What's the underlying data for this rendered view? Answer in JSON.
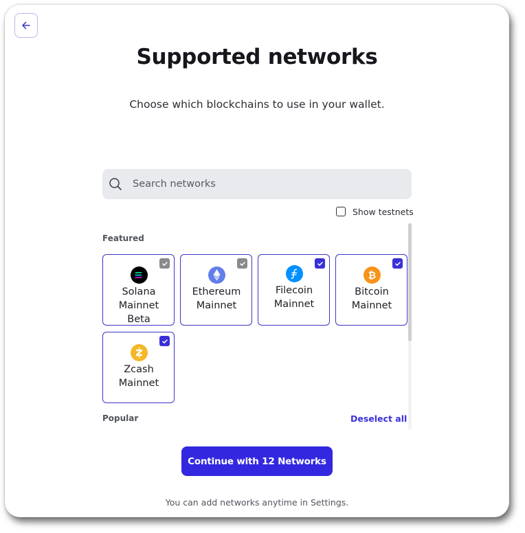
{
  "header": {
    "title": "Supported networks",
    "subtitle": "Choose which blockchains to use in your wallet."
  },
  "search": {
    "placeholder": "Search networks"
  },
  "testnets": {
    "label": "Show testnets",
    "checked": false
  },
  "sections": {
    "featured_label": "Featured",
    "popular_label": "Popular",
    "deselect_all": "Deselect all"
  },
  "networks": [
    {
      "name": "Solana Mainnet Beta",
      "icon": "solana-icon",
      "checkbox": "locked-checked",
      "color": "#000000"
    },
    {
      "name": "Ethereum Mainnet",
      "icon": "ethereum-icon",
      "checkbox": "locked-checked",
      "color": "#627eea"
    },
    {
      "name": "Filecoin Mainnet",
      "icon": "filecoin-icon",
      "checkbox": "checked",
      "color": "#0090ff"
    },
    {
      "name": "Bitcoin Mainnet",
      "icon": "bitcoin-icon",
      "checkbox": "checked",
      "color": "#f7931a"
    },
    {
      "name": "Zcash Mainnet",
      "icon": "zcash-icon",
      "checkbox": "checked",
      "color": "#f4b728"
    }
  ],
  "actions": {
    "continue_label": "Continue with 12 Networks"
  },
  "footer": {
    "note": "You can add networks anytime in Settings."
  },
  "colors": {
    "accent": "#3328df",
    "border": "#3c34c9",
    "locked_check": "#8a8a8e"
  }
}
